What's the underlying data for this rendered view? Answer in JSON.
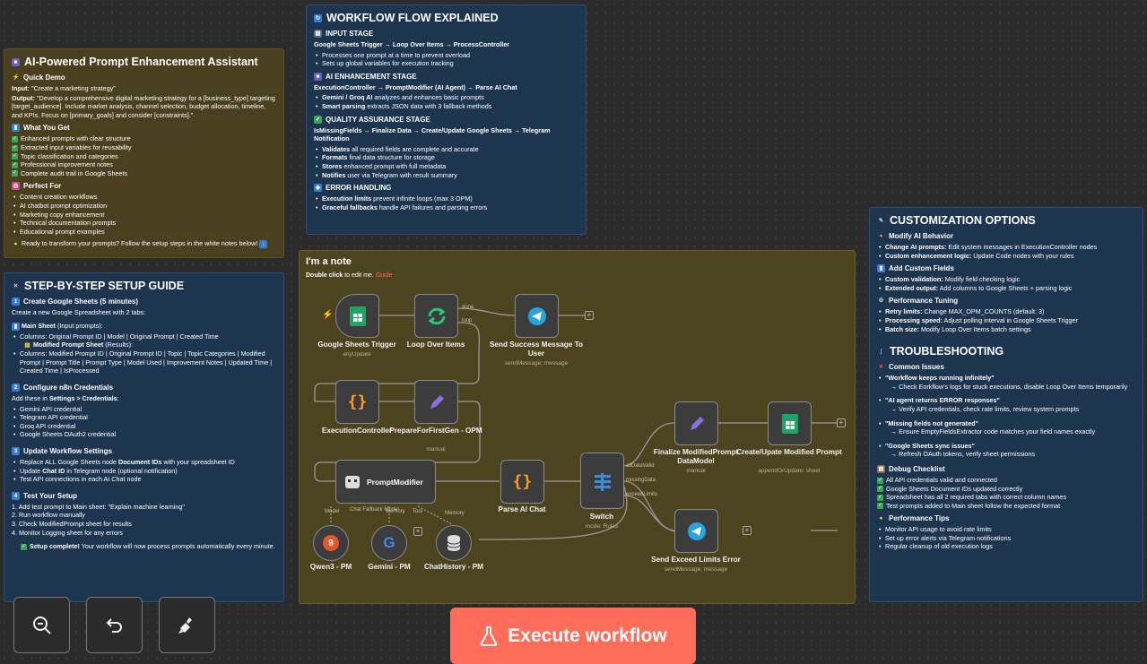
{
  "note_assistant": {
    "title": "AI-Powered Prompt Enhancement Assistant",
    "quick_demo": "Quick Demo",
    "input_label": "Input:",
    "input_value": "\"Create a marketing strategy\"",
    "output_label": "Output:",
    "output_value": "\"Develop a comprehensive digital marketing strategy for a [business_type] targeting [target_audience]. Include market analysis, channel selection, budget allocation, timeline, and KPIs. Focus on [primary_goals] and consider [constraints].\"",
    "what_you_get": "What You Get",
    "get_items": [
      "Enhanced prompts with clear structure",
      "Extracted input variables for reusability",
      "Topic classification and categories",
      "Professional improvement notes",
      "Complete audit trail in Google Sheets"
    ],
    "perfect_for": "Perfect For",
    "for_items": [
      "Content creation workflows",
      "AI chatbot prompt optimization",
      "Marketing copy enhancement",
      "Technical documentation prompts",
      "Educational prompt examples"
    ],
    "footer": "Ready to transform your prompts? Follow the setup steps in the white notes below!"
  },
  "note_flow": {
    "title": "WORKFLOW FLOW EXPLAINED",
    "s1_title": "INPUT STAGE",
    "s1_path": "Google Sheets Trigger → Loop Over Items → ProcessController",
    "s1_items": [
      "Processes one prompt at a time to prevent overload",
      "Sets up global variables for execution tracking"
    ],
    "s2_title": "AI ENHANCEMENT STAGE",
    "s2_path": "ExecutionController → PromptModifier (AI Agent) → Parse AI Chat",
    "s2_items": [
      {
        "b": "Gemini / Groq AI",
        "t": " analyzes and enhances basic prompts"
      },
      {
        "b": "Smart parsing",
        "t": " extracts JSON data with 3 fallback methods"
      }
    ],
    "s3_title": "QUALITY ASSURANCE STAGE",
    "s3_path": "IsMissingFields → Finalize Data → Create/Update Google Sheets → Telegram Notification",
    "s3_items": [
      {
        "b": "Validates",
        "t": " all required fields are complete and accurate"
      },
      {
        "b": "Formats",
        "t": " final data structure for storage"
      },
      {
        "b": "Stores",
        "t": " enhanced prompt with full metadata"
      },
      {
        "b": "Notifies",
        "t": " user via Telegram with result summary"
      }
    ],
    "s4_title": "ERROR HANDLING",
    "s4_items": [
      {
        "b": "Execution limits",
        "t": " prevent infinite loops (max 3 OPM)"
      },
      {
        "b": "Graceful fallbacks",
        "t": " handle API failures and parsing errors"
      }
    ]
  },
  "note_setup": {
    "title": "STEP-BY-STEP SETUP GUIDE",
    "step1": "Create Google Sheets (5 minutes)",
    "step1_text": "Create a new Google Spreadsheet with 2 tabs:",
    "main_sheet": "Main Sheet",
    "main_sheet_note": " (Input prompts):",
    "main_cols": "Columns: Original Prompt ID | Model | Original Prompt | Created Time",
    "mod_sheet": "Modified Prompt Sheet",
    "mod_sheet_note": " (Results):",
    "mod_cols": "Columns: Modified Prompt ID | Original Prompt ID | Topic | Topic Categories | Modified Prompt | Prompt Title | Prompt Type | Model Used | Improvement Notes | Updated Time | Created Time | IsProcessed",
    "step2": "Configure n8n Credentials",
    "step2_text_a": "Add these in ",
    "step2_text_b": "Settings > Credentials",
    "step2_text_c": ":",
    "cred_items": [
      "Gemini API credential",
      "Telegram API credential",
      "Groq API credential",
      "Google Sheets OAuth2 credential"
    ],
    "step3": "Update Workflow Settings",
    "s3_a": "Replace ALL Google Sheets node ",
    "s3_b": "Document IDs",
    "s3_c": " with your spreadsheet ID",
    "s3_d": "Update ",
    "s3_e": "Chat ID",
    "s3_f": " in Telegram node (optional notification)",
    "s3_g": "Test API connections in each AI Chat node",
    "step4": "Test Your Setup",
    "test_items": [
      "1. Add test prompt to Main sheet: \"Explain machine learning\"",
      "2. Run workflow manually",
      "3. Check ModifiedPrompt sheet for results",
      "4. Monitor Logging sheet for any errors"
    ],
    "complete_b": "Setup complete!",
    "complete_t": " Your workflow will now process prompts automatically every minute."
  },
  "note_custom": {
    "title": "CUSTOMIZATION OPTIONS",
    "m1": "Modify AI Behavior",
    "m1_items": [
      {
        "b": "Change AI prompts:",
        "t": " Edit system messages in ExecutionController nodes"
      },
      {
        "b": "Custom enhancement logic:",
        "t": " Update Code nodes with your rules"
      }
    ],
    "m2": "Add Custom Fields",
    "m2_items": [
      {
        "b": "Custom validation:",
        "t": " Modify field checking logic"
      },
      {
        "b": "Extended output:",
        "t": " Add columns to Google Sheets + parsing logic"
      }
    ],
    "m3": "Performance Tuning",
    "m3_items": [
      {
        "b": "Retry limits:",
        "t": " Change MAX_OPM_COUNTS (default: 3)"
      },
      {
        "b": "Processing speed:",
        "t": " Adjust polling interval in Google Sheets Trigger"
      },
      {
        "b": "Batch size:",
        "t": " Modify Loop Over Items batch settings"
      }
    ],
    "ts_title": "TROUBLESHOOTING",
    "common": "Common Issues",
    "issues": [
      {
        "q": "\"Workflow keeps running infinitely\"",
        "a": "→ Check Eorkflow's logs for stuck executions, disable Loop Over Items temporarily"
      },
      {
        "q": "\"AI agent returns ERROR responses\"",
        "a": "→ Verify API credentials, check rate limits, review system prompts"
      },
      {
        "q": "\"Missing fields not generated\"",
        "a": "→ Ensure EmptyFieldsExtractor code matches your field names exactly"
      },
      {
        "q": "\"Google Sheets sync issues\"",
        "a": "→ Refresh OAuth tokens, verify sheet permissions"
      }
    ],
    "debug": "Debug Checklist",
    "debug_items": [
      "All API credentials valid and connected",
      "Google Sheets Document IDs updated correctly",
      "Spreadsheet has all 2 required tabs with correct column names",
      "Test prompts added to Main sheet follow the expected format"
    ],
    "perf": "Performance Tips",
    "perf_items": [
      "Monitor API usage to avoid rate limits",
      "Set up error alerts via Telegram notifications",
      "Regular cleanup of old execution logs"
    ]
  },
  "canvas_note": {
    "title": "I'm a note",
    "hint_a": "Double click",
    "hint_b": " to edit me. ",
    "hint_link": "Guide"
  },
  "nodes": {
    "trigger": {
      "label": "Google Sheets Trigger",
      "sub": "anyUpdate"
    },
    "loop": {
      "label": "Loop Over Items"
    },
    "success": {
      "label": "Send Success Message To User",
      "sub": "sendMessage: message"
    },
    "exec_ctrl": {
      "label": "ExecutionController"
    },
    "prepare": {
      "label": "PrepareForFirstGen - OPM",
      "sub": "manual"
    },
    "prompt_mod": {
      "label": "PromptModifier"
    },
    "parse": {
      "label": "Parse AI Chat"
    },
    "switch": {
      "label": "Switch",
      "sub": "mode: Rules"
    },
    "finalize": {
      "label": "Finalize ModifiedPrompt DataModel",
      "sub": "manual"
    },
    "create": {
      "label": "Create/Upate Modified Prompt",
      "sub": "appendOrUpdate: sheet"
    },
    "exceed": {
      "label": "Send Exceed Limits Error",
      "sub": "sendMessage: message"
    },
    "qwen": {
      "label": "Qwen3 - PM"
    },
    "gemini": {
      "label": "Gemini - PM"
    },
    "chat_history": {
      "label": "ChatHistory - PM"
    }
  },
  "edges": {
    "done": "done",
    "loop": "loop",
    "all_data_valid": "allDataValid",
    "missing_data": "missingData",
    "exceed_limits": "exceedLimits",
    "model": "Model",
    "fallback": "Chat Fallback Model",
    "memory": "Memory",
    "tool": "Tool"
  },
  "toolbar": {
    "zoom_out": "zoom-out-icon",
    "undo": "undo-icon",
    "tidy": "broom-icon",
    "execute": "Execute workflow"
  },
  "colors": {
    "accent": "#ff6d5a",
    "note_blue": "#1e3550",
    "note_olive": "#4a3f1f",
    "sheets": "#1fa463",
    "telegram": "#2aa3dd",
    "code": "#ff9b26",
    "edit": "#8b6fe0"
  }
}
